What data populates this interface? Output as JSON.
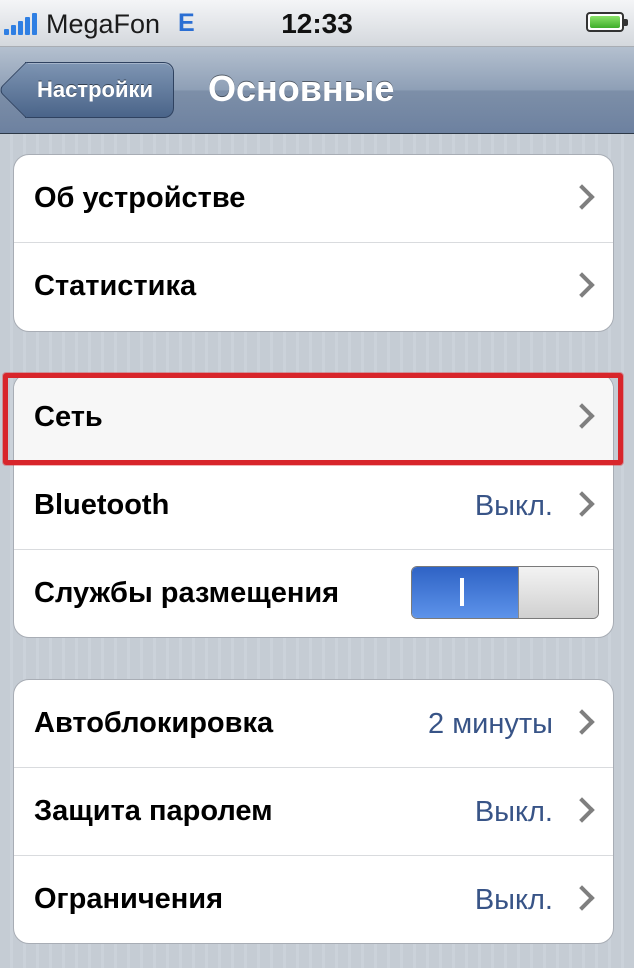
{
  "status_bar": {
    "carrier": "MegaFon",
    "network_type": "E",
    "time": "12:33",
    "signal_icon": "signal-bars-icon",
    "battery_icon": "battery-icon"
  },
  "nav_bar": {
    "back_label": "Настройки",
    "title": "Основные"
  },
  "groups": [
    {
      "items": [
        {
          "label": "Об устройстве",
          "value": ""
        },
        {
          "label": "Статистика",
          "value": ""
        }
      ]
    },
    {
      "items": [
        {
          "label": "Сеть",
          "value": ""
        },
        {
          "label": "Bluetooth",
          "value": "Выкл."
        },
        {
          "label": "Службы размещения",
          "switch": "on",
          "switch_on_glyph": "I"
        }
      ]
    },
    {
      "items": [
        {
          "label": "Автоблокировка",
          "value": "2 минуты"
        },
        {
          "label": "Защита паролем",
          "value": "Выкл."
        },
        {
          "label": "Ограничения",
          "value": "Выкл."
        }
      ]
    }
  ],
  "colors": {
    "value_text": "#385487",
    "highlight_frame": "#d8252b",
    "switch_on": "#2f63c5"
  }
}
